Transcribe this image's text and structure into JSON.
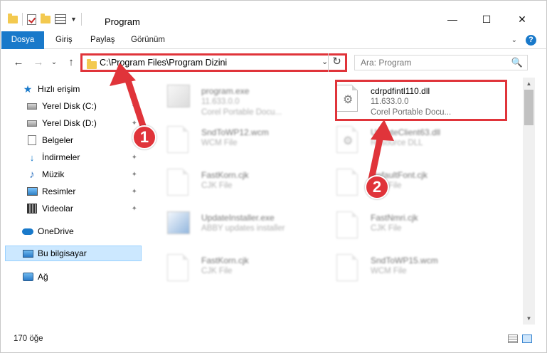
{
  "window": {
    "title": "Program",
    "minimize_glyph": "—",
    "maximize_glyph": "☐",
    "close_glyph": "✕"
  },
  "ribbon": {
    "tabs": [
      "Dosya",
      "Giriş",
      "Paylaş",
      "Görünüm"
    ],
    "help_glyph": "?",
    "expand_glyph": "⌄"
  },
  "address": {
    "path": "C:\\Program Files\\Program Dizini",
    "dropdown_glyph": "⌄",
    "refresh_glyph": "↻"
  },
  "search": {
    "placeholder": "Ara: Program",
    "icon": "🔍"
  },
  "nav": {
    "back_glyph": "←",
    "forward_glyph": "→",
    "recent_glyph": "⌄",
    "up_glyph": "↑"
  },
  "sidebar": {
    "items": [
      {
        "label": "Hızlı erişim",
        "icon": "star-icon"
      },
      {
        "label": "Yerel Disk (C:)",
        "icon": "disk-icon",
        "pinned": true
      },
      {
        "label": "Yerel Disk (D:)",
        "icon": "disk-icon",
        "pinned": true
      },
      {
        "label": "Belgeler",
        "icon": "document-icon",
        "pinned": true
      },
      {
        "label": "İndirmeler",
        "icon": "download-icon",
        "pinned": true
      },
      {
        "label": "Müzik",
        "icon": "music-icon",
        "pinned": true
      },
      {
        "label": "Resimler",
        "icon": "pictures-icon",
        "pinned": true
      },
      {
        "label": "Videolar",
        "icon": "video-icon",
        "pinned": true
      },
      {
        "label": "OneDrive",
        "icon": "cloud-icon"
      },
      {
        "label": "Bu bilgisayar",
        "icon": "computer-icon",
        "selected": true
      },
      {
        "label": "Ağ",
        "icon": "network-icon"
      }
    ],
    "pin_glyph": "📌"
  },
  "files": [
    {
      "name": "program.exe",
      "version": "11.633.0.0",
      "type": "Corel Portable Docu...",
      "faded": true
    },
    {
      "name": "cdrpdfintl110.dll",
      "version": "11.633.0.0",
      "type": "Corel Portable Docu...",
      "faded": false
    },
    {
      "name": "SndToWP12.wcm",
      "version": "WCM File",
      "type": "",
      "faded": true
    },
    {
      "name": "UpdateClient63.dll",
      "version": "Resource DLL",
      "type": "",
      "faded": true
    },
    {
      "name": "FastKorn.cjk",
      "version": "CJK File",
      "type": "",
      "faded": true
    },
    {
      "name": "DefaultFont.cjk",
      "version": "CJK File",
      "type": "",
      "faded": true
    },
    {
      "name": "UpdateInstaller.exe",
      "version": "ABBY updates installer",
      "type": "",
      "faded": true
    },
    {
      "name": "FastNmri.cjk",
      "version": "CJK File",
      "type": "",
      "faded": true
    },
    {
      "name": "FastKorn.cjk",
      "version": "CJK File",
      "type": "",
      "faded": true
    },
    {
      "name": "SndToWP15.wcm",
      "version": "WCM File",
      "type": "",
      "faded": true
    }
  ],
  "status": {
    "count": "170 öğe"
  },
  "callouts": [
    "1",
    "2"
  ],
  "colors": {
    "accent": "#1979ca",
    "highlight_red": "#e0343a",
    "selected_bg": "#cce8ff"
  }
}
